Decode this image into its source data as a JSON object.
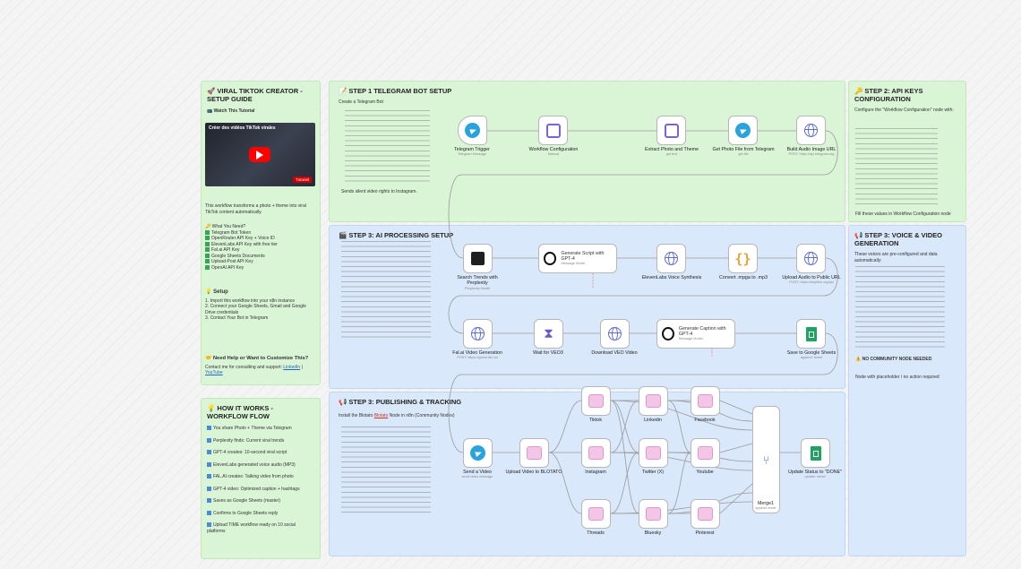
{
  "setup": {
    "title": "🚀 VIRAL TIKTOK CREATOR - SETUP GUIDE",
    "watch": "📺 Watch This Tutorial",
    "video_caption": "Créer des vidéos TikTok virales",
    "video_brand": "Tutoriel",
    "intro": "This workflow transforms a photo + theme into viral TikTok content automatically.",
    "need_head": "🔑 What You Need?",
    "needs": [
      "Telegram Bot Token",
      "OpenRouter API Key + Voice ID",
      "ElevenLabs API Key with free tier",
      "Fal.ai API Key",
      "Google Sheets Documents",
      "Upload-Post API Key",
      "OpenAI API Key"
    ],
    "setup_head": "💡 Setup",
    "steps": [
      "Import this workflow into your n8n instance",
      "Connect your Google Sheets, Gmail and Google Drive credentials",
      "Contact Your Bot in Telegram"
    ],
    "help_head": "🤝 Need Help or Want to Customize This?",
    "help_text": "Contact me for consulting and support:",
    "link1": "LinkedIn",
    "link2": "YouTube"
  },
  "how": {
    "title": "💡 HOW IT WORKS - WORKFLOW FLOW",
    "items": [
      "You share Photo + Theme via Telegram",
      "Perplexity finds: Current viral trends",
      "GPT-4 creates: 10-second viral script",
      "ElevenLabs generated voice audio (MP3)",
      "FAL.AI creates: Talking video from photo",
      "GPT-4 video: Optimized caption + hashtags",
      "Saves as Google Sheets (master)",
      "Confirms to Google Sheets reply",
      "Upload TIME workflow ready on 10 social platforms"
    ]
  },
  "step1": {
    "title": "📝 STEP 1 TELEGRAM BOT SETUP",
    "intro": "Create a Telegram Bot",
    "footer": "Sends silent video rights to Instagram."
  },
  "step2": {
    "title": "🔑 STEP 2: API KEYS CONFIGURATION",
    "intro": "Configure the \"Workflow Configuration\" node with:",
    "footer": "Fill these values in Workflow Configuration node"
  },
  "step3a": {
    "title": "🎬 STEP 3: AI PROCESSING SETUP"
  },
  "step3b": {
    "title": "📢 STEP 3: VOICE & VIDEO GENERATION",
    "intro": "These voices are pre-configured and data automatically:",
    "warning": "⚠️ NO COMMUNITY NODE NEEDED",
    "footer": "Node with placeholder / no action required"
  },
  "step3c": {
    "title": "📢 STEP 3: PUBLISHING & TRACKING",
    "intro_pre": "Install the Blotato ",
    "intro_link": "Blotato",
    "intro_post": " Node in n8n (Community Nodes)"
  },
  "nodes": {
    "telegram_trigger": {
      "label": "Telegram Trigger",
      "sub": "Telegram Message"
    },
    "workflow_config": {
      "label": "Workflow Configuration",
      "sub": "Manual"
    },
    "extract_photo": {
      "label": "Extract Photo and Theme",
      "sub": "get text"
    },
    "get_photo": {
      "label": "Get Photo File from Telegram",
      "sub": "get file"
    },
    "build_url": {
      "label": "Build Audio Image URL",
      "sub": "POST: https://api.telegram.org"
    },
    "search_trends": {
      "label": "Search Trends with Perplexity",
      "sub": "Perplexity Model"
    },
    "generate_script": {
      "label": "Generate Script with GPT-4",
      "sub": "Message Model"
    },
    "voice_synthesis": {
      "label": "ElevenLabs Voice Synthesis",
      "sub": ""
    },
    "convert_mp3": {
      "label": "Convert .mpga to .mp3",
      "sub": ""
    },
    "upload_audio": {
      "label": "Upload Audio to Public URL",
      "sub": "POST: https://tmpfiles.org/api"
    },
    "fal_video": {
      "label": "Fal.ai Video Generation",
      "sub": "POST: https://queue.fal.run"
    },
    "wait_veo": {
      "label": "Wait for VEO3",
      "sub": ""
    },
    "download_video": {
      "label": "Download VEO Video",
      "sub": ""
    },
    "generate_caption": {
      "label": "Generate Caption with GPT-4",
      "sub": "Message Model"
    },
    "save_sheets": {
      "label": "Save to Google Sheets",
      "sub": "append: sheet"
    },
    "send_video": {
      "label": "Send a Video",
      "sub": "send video message"
    },
    "upload_blotato": {
      "label": "Upload Video to BLOTATO",
      "sub": ""
    },
    "tiktok": {
      "label": "Tiktok",
      "sub": ""
    },
    "linkedin": {
      "label": "Linkedin",
      "sub": ""
    },
    "facebook": {
      "label": "Facebook",
      "sub": ""
    },
    "instagram": {
      "label": "Instagram",
      "sub": ""
    },
    "twitter": {
      "label": "Twitter (X)",
      "sub": ""
    },
    "youtube": {
      "label": "Youtube",
      "sub": ""
    },
    "threads": {
      "label": "Threads",
      "sub": ""
    },
    "bluesky": {
      "label": "Bluesky",
      "sub": ""
    },
    "pinterest": {
      "label": "Pinterest",
      "sub": ""
    },
    "merge": {
      "label": "Merge1",
      "sub": "append mode"
    },
    "update_status": {
      "label": "Update Status to \"DONE\"",
      "sub": "update: sheet"
    }
  },
  "colors": {
    "green_note": "#daf5d6",
    "blue_note": "#d9e8fb",
    "telegram": "#2aa3dd",
    "sheets": "#1ea362"
  }
}
